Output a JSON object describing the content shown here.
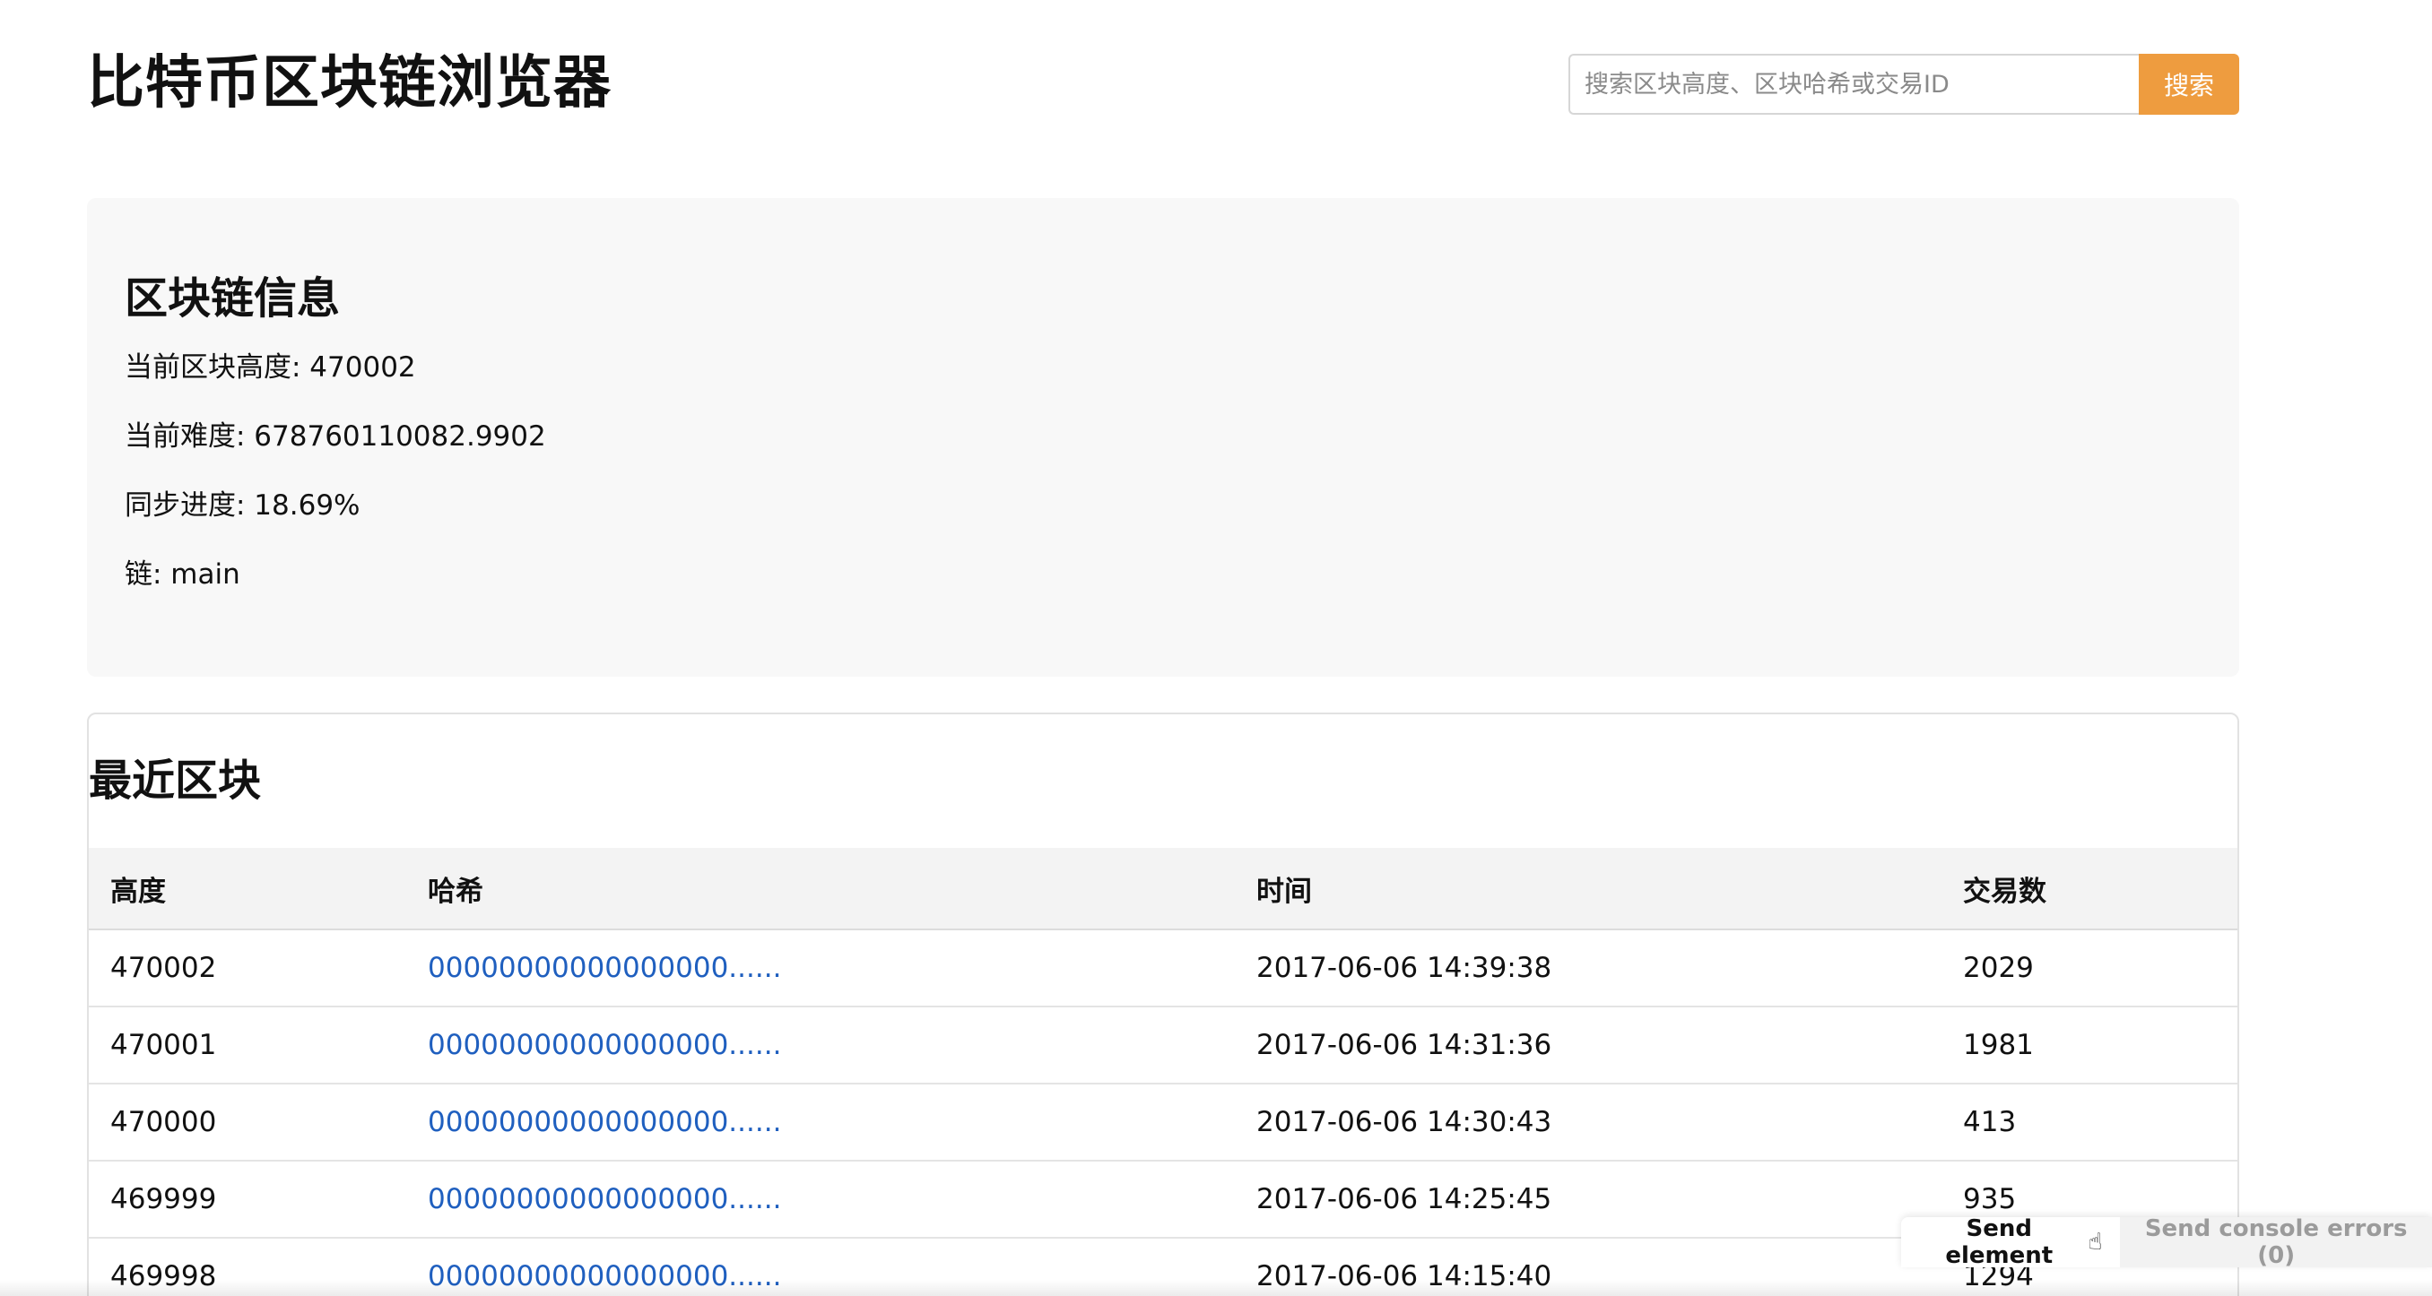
{
  "header": {
    "title": "比特币区块链浏览器",
    "search_placeholder": "搜索区块高度、区块哈希或交易ID",
    "search_button": "搜索"
  },
  "info": {
    "title": "区块链信息",
    "lines": [
      "当前区块高度: 470002",
      "当前难度: 678760110082.9902",
      "同步进度: 18.69%",
      "链: main"
    ]
  },
  "recent": {
    "title": "最近区块",
    "columns": [
      "高度",
      "哈希",
      "时间",
      "交易数"
    ],
    "rows": [
      {
        "height": "470002",
        "hash": "00000000000000000......",
        "time": "2017-06-06 14:39:38",
        "txs": "2029"
      },
      {
        "height": "470001",
        "hash": "00000000000000000......",
        "time": "2017-06-06 14:31:36",
        "txs": "1981"
      },
      {
        "height": "470000",
        "hash": "00000000000000000......",
        "time": "2017-06-06 14:30:43",
        "txs": "413"
      },
      {
        "height": "469999",
        "hash": "00000000000000000......",
        "time": "2017-06-06 14:25:45",
        "txs": "935"
      },
      {
        "height": "469998",
        "hash": "00000000000000000......",
        "time": "2017-06-06 14:15:40",
        "txs": "1294"
      }
    ]
  },
  "devtools": {
    "send_element": "Send element",
    "send_console": "Send console errors (0)"
  },
  "colors": {
    "accent": "#ee9c3f",
    "link": "#1f5fbf",
    "card_bg": "#f8f8f8"
  }
}
